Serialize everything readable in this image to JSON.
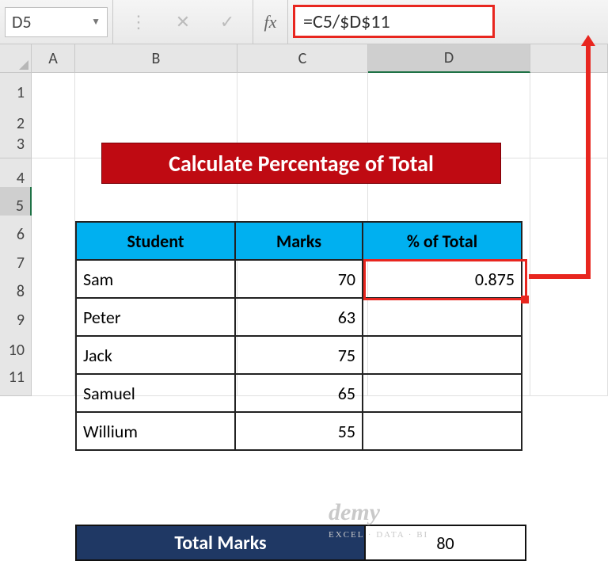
{
  "formula_bar": {
    "name_box": "D5",
    "fx_label": "fx",
    "formula": "=C5/$D$11"
  },
  "columns": [
    "A",
    "B",
    "C",
    "D"
  ],
  "rows": [
    "1",
    "2",
    "3",
    "4",
    "5",
    "6",
    "7",
    "8",
    "9",
    "10",
    "11"
  ],
  "active_cell": {
    "col": "D",
    "row": "5"
  },
  "banner": "Calculate Percentage of Total",
  "table": {
    "headers": {
      "student": "Student",
      "marks": "Marks",
      "pct": "% of Total"
    },
    "rows": [
      {
        "student": "Sam",
        "marks": "70",
        "pct": "0.875"
      },
      {
        "student": "Peter",
        "marks": "63",
        "pct": ""
      },
      {
        "student": "Jack",
        "marks": "75",
        "pct": ""
      },
      {
        "student": "Samuel",
        "marks": "65",
        "pct": ""
      },
      {
        "student": "Willium",
        "marks": "55",
        "pct": ""
      }
    ]
  },
  "total": {
    "label": "Total Marks",
    "value": "80"
  },
  "watermark": {
    "brand": "demy",
    "tag": "EXCEL · DATA · BI"
  }
}
